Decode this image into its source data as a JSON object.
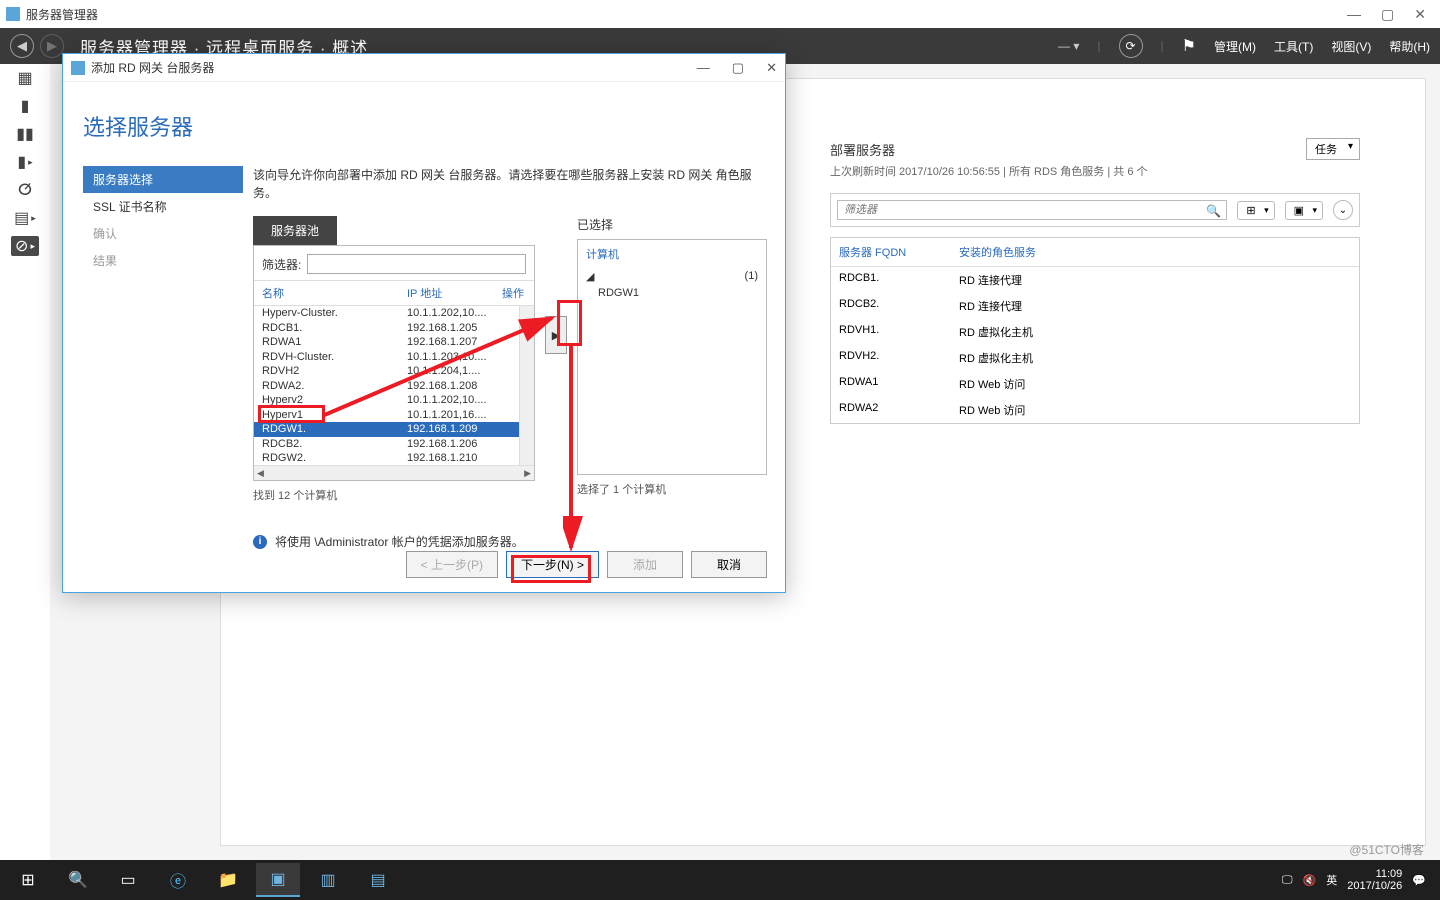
{
  "outer": {
    "title": "服务器管理器"
  },
  "toolbar": {
    "breadcrumb": "服务器管理器 · 远程桌面服务 · 概述",
    "menu": {
      "manage": "管理(M)",
      "tools": "工具(T)",
      "view": "视图(V)",
      "help": "帮助(H)"
    }
  },
  "deploy": {
    "title": "部署服务器",
    "sub": "上次刷新时间 2017/10/26 10:56:55 | 所有 RDS 角色服务 | 共 6 个",
    "tasks": "任务",
    "filter_placeholder": "筛选器",
    "hdr": {
      "fqdn": "服务器 FQDN",
      "roles": "安装的角色服务"
    },
    "rows": [
      {
        "fqdn": "RDCB1.",
        "role": "RD 连接代理"
      },
      {
        "fqdn": "RDCB2.",
        "role": "RD 连接代理"
      },
      {
        "fqdn": "RDVH1.",
        "role": "RD 虚拟化主机"
      },
      {
        "fqdn": "RDVH2.",
        "role": "RD 虚拟化主机"
      },
      {
        "fqdn": "RDWA1",
        "role": "RD Web 访问"
      },
      {
        "fqdn": "RDWA2",
        "role": "RD Web 访问"
      }
    ]
  },
  "dialog": {
    "title": "添加 RD 网关 台服务器",
    "heading": "选择服务器",
    "steps": {
      "s1": "服务器选择",
      "s2": "SSL 证书名称",
      "s3": "确认",
      "s4": "结果"
    },
    "desc": "该向导允许你向部署中添加 RD 网关 台服务器。请选择要在哪些服务器上安装 RD 网关 角色服务。",
    "pool_tab": "服务器池",
    "filter_label": "筛选器:",
    "listhdr": {
      "name": "名称",
      "ip": "IP 地址",
      "op": "操作"
    },
    "pool": [
      {
        "n": "Hyperv-Cluster.",
        "ip": "10.1.1.202,10...."
      },
      {
        "n": "RDCB1.",
        "ip": "192.168.1.205"
      },
      {
        "n": "RDWA1",
        "ip": "192.168.1.207"
      },
      {
        "n": "RDVH-Cluster.",
        "ip": "10.1.1.203,10...."
      },
      {
        "n": "RDVH2",
        "ip": "10.1.1.204,1...."
      },
      {
        "n": "RDWA2.",
        "ip": "192.168.1.208"
      },
      {
        "n": "Hyperv2",
        "ip": "10.1.1.202,10...."
      },
      {
        "n": "Hyperv1",
        "ip": "10.1.1.201,16...."
      },
      {
        "n": "RDGW1.",
        "ip": "192.168.1.209",
        "sel": true
      },
      {
        "n": "RDCB2.",
        "ip": "192.168.1.206"
      },
      {
        "n": "RDGW2.",
        "ip": "192.168.1.210"
      }
    ],
    "found": "找到 12 个计算机",
    "selected_hdr": "已选择",
    "selected_col": "计算机",
    "selected_count": "(1)",
    "selected_item": "RDGW1",
    "selected_footer": "选择了 1 个计算机",
    "note": "将使用            \\Administrator 帐户的凭据添加服务器。",
    "btns": {
      "prev": "< 上一步(P)",
      "next": "下一步(N) >",
      "add": "添加",
      "cancel": "取消"
    }
  },
  "taskbar": {
    "ime": "英",
    "time": "11:09",
    "date": "2017/10/26"
  },
  "watermark": "@51CTO博客"
}
